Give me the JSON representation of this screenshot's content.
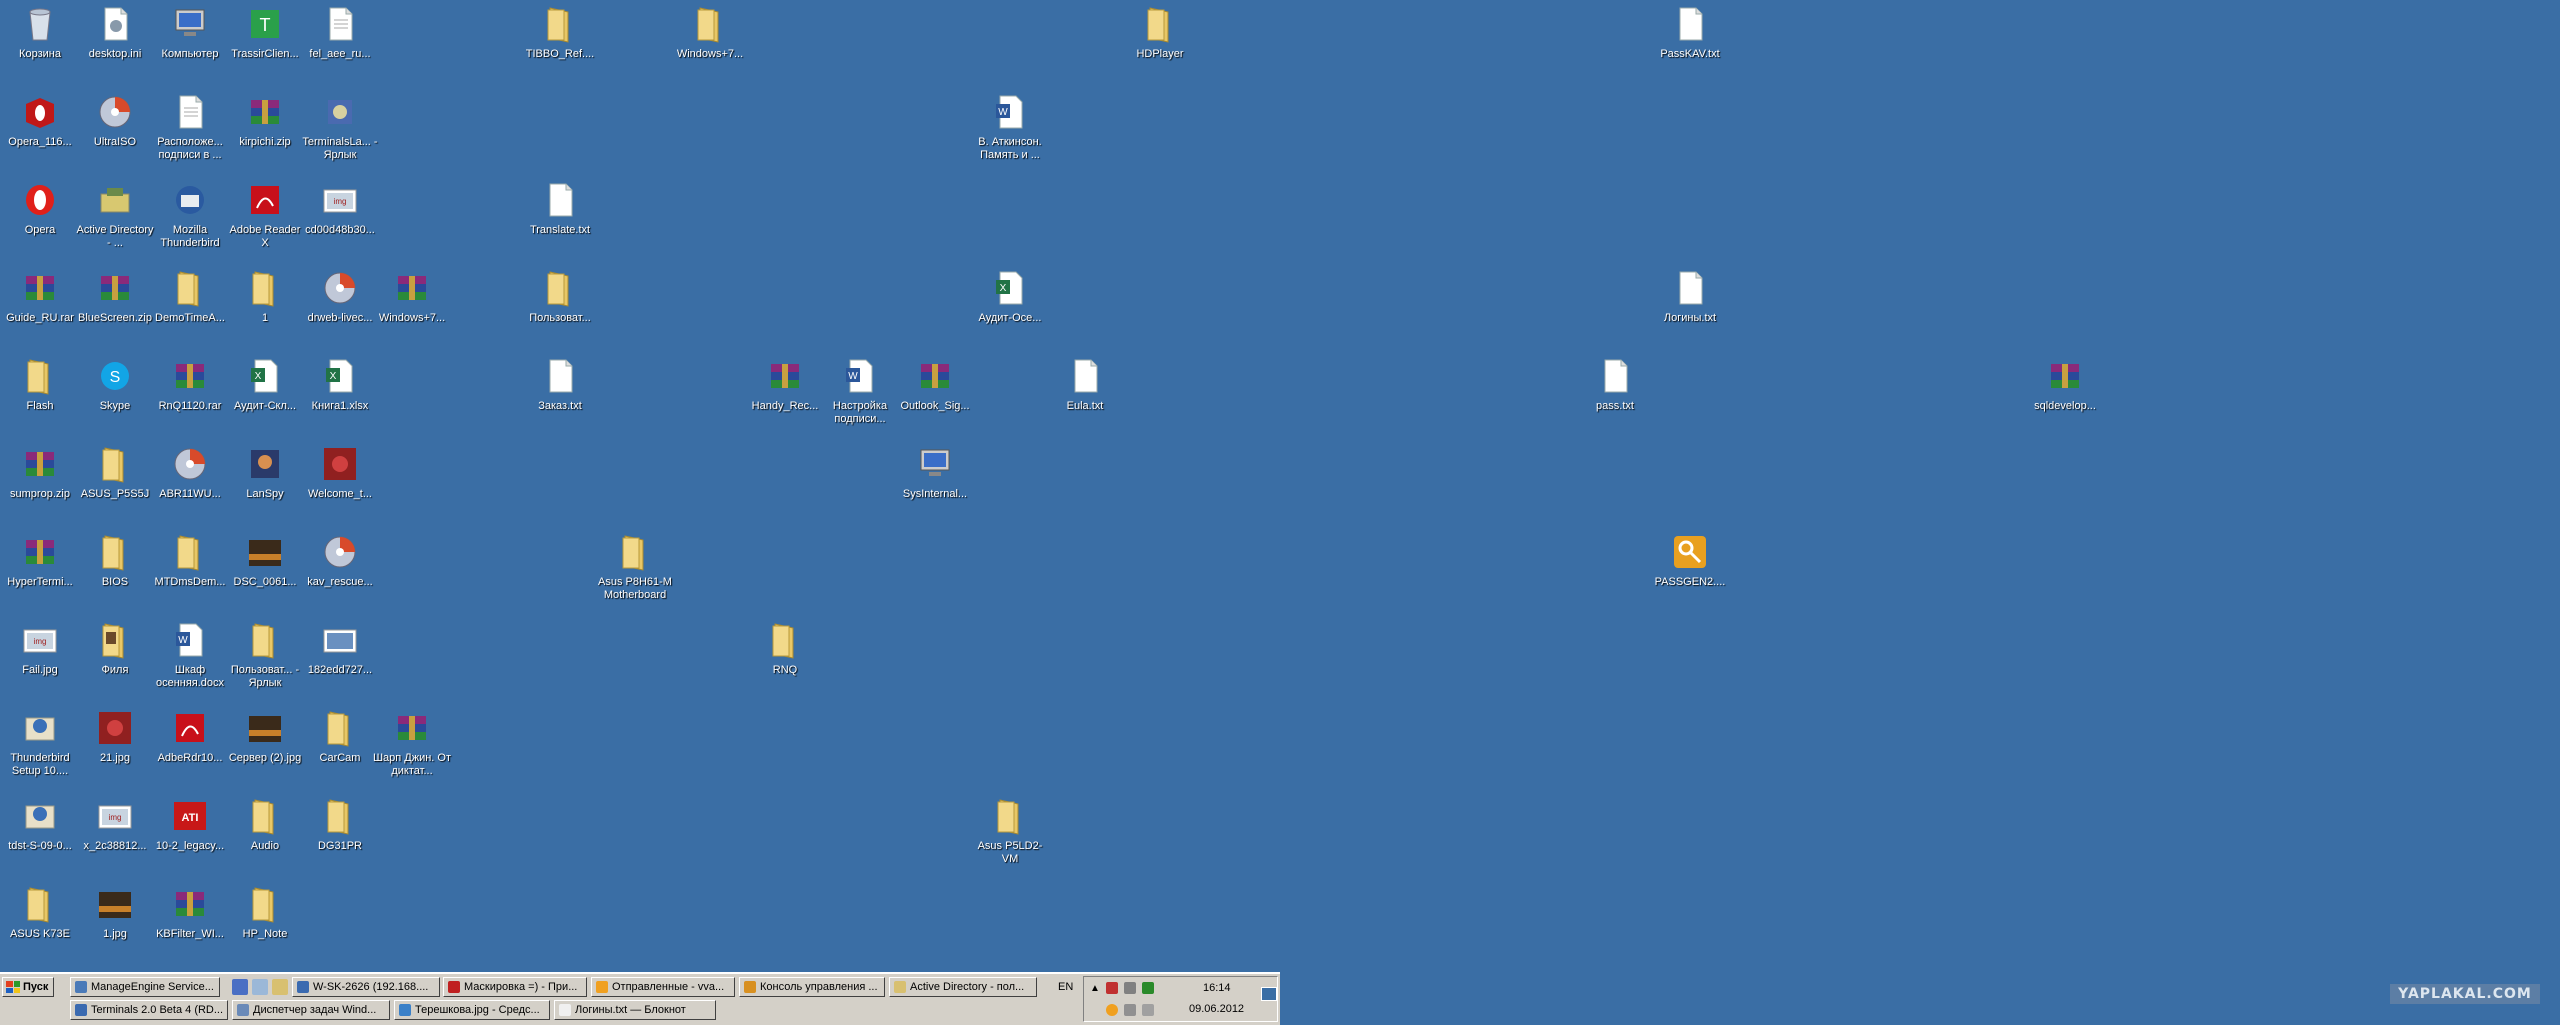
{
  "desktop": {
    "icons": [
      {
        "label": "Корзина",
        "type": "recycle"
      },
      {
        "label": "desktop.ini",
        "type": "ini"
      },
      {
        "label": "Компьютер",
        "type": "computer"
      },
      {
        "label": "TrassirClien...",
        "type": "app-green"
      },
      {
        "label": "fel_aee_ru...",
        "type": "doc"
      },
      {
        "label": "TIBBO_Ref....",
        "type": "folder"
      },
      {
        "label": "Windows+7...",
        "type": "folder"
      },
      {
        "label": "HDPlayer",
        "type": "folder"
      },
      {
        "label": "PassKAV.txt",
        "type": "txt"
      },
      {
        "label": "Opera_116...",
        "type": "opera-box"
      },
      {
        "label": "UltraISO",
        "type": "disc"
      },
      {
        "label": "Расположе... подписи в ...",
        "type": "doc"
      },
      {
        "label": "kirpichi.zip",
        "type": "rar"
      },
      {
        "label": "TerminalsLa... - Ярлык",
        "type": "app-shortcut"
      },
      {
        "label": "В. Аткинсон. Память и ...",
        "type": "word"
      },
      {
        "label": "Opera",
        "type": "opera"
      },
      {
        "label": "Active Directory - ...",
        "type": "tools"
      },
      {
        "label": "Mozilla Thunderbird",
        "type": "thunderbird"
      },
      {
        "label": "Adobe Reader X",
        "type": "pdf"
      },
      {
        "label": "cd00d48b30...",
        "type": "image"
      },
      {
        "label": "Translate.txt",
        "type": "txt"
      },
      {
        "label": "Guide_RU.rar",
        "type": "rar"
      },
      {
        "label": "BlueScreen.zip",
        "type": "rar"
      },
      {
        "label": "DemoTimeA...",
        "type": "folder"
      },
      {
        "label": "1",
        "type": "folder"
      },
      {
        "label": "drweb-livec...",
        "type": "disc"
      },
      {
        "label": "Windows+7...",
        "type": "rar"
      },
      {
        "label": "Пользоват...",
        "type": "folder"
      },
      {
        "label": "Аудит-Осе...",
        "type": "excel"
      },
      {
        "label": "Логины.txt",
        "type": "txt"
      },
      {
        "label": "Flash",
        "type": "folder"
      },
      {
        "label": "Skype",
        "type": "skype"
      },
      {
        "label": "RnQ1120.rar",
        "type": "rar"
      },
      {
        "label": "Аудит-Скл...",
        "type": "excel"
      },
      {
        "label": "Книга1.xlsx",
        "type": "excel"
      },
      {
        "label": "Заказ.txt",
        "type": "txt"
      },
      {
        "label": "Handy_Rec...",
        "type": "rar"
      },
      {
        "label": "Настройка подписи...",
        "type": "word"
      },
      {
        "label": "Outlook_Sig...",
        "type": "rar"
      },
      {
        "label": "Eula.txt",
        "type": "txt"
      },
      {
        "label": "pass.txt",
        "type": "txt"
      },
      {
        "label": "sqldevelop...",
        "type": "rar"
      },
      {
        "label": "sumprop.zip",
        "type": "rar"
      },
      {
        "label": "ASUS_P5S5J",
        "type": "folder"
      },
      {
        "label": "ABR11WU...",
        "type": "disc"
      },
      {
        "label": "LanSpy",
        "type": "lanspy"
      },
      {
        "label": "Welcome_t...",
        "type": "photo-red"
      },
      {
        "label": "SysInternal...",
        "type": "monitor"
      },
      {
        "label": "HyperTermi...",
        "type": "rar"
      },
      {
        "label": "BIOS",
        "type": "folder"
      },
      {
        "label": "MTDmsDem...",
        "type": "folder"
      },
      {
        "label": "DSC_0061...",
        "type": "photo-dark"
      },
      {
        "label": "kav_rescue...",
        "type": "disc"
      },
      {
        "label": "Asus P8H61-M Motherboard",
        "type": "folder"
      },
      {
        "label": "PASSGEN2....",
        "type": "key"
      },
      {
        "label": "Fail.jpg",
        "type": "image"
      },
      {
        "label": "Филя",
        "type": "folder-img"
      },
      {
        "label": "Шкаф осенняя.docx",
        "type": "word"
      },
      {
        "label": "Пользоват... - Ярлык",
        "type": "folder"
      },
      {
        "label": "182edd727...",
        "type": "photo-sky"
      },
      {
        "label": "RNQ",
        "type": "folder"
      },
      {
        "label": "Thunderbird Setup 10....",
        "type": "setup"
      },
      {
        "label": "21.jpg",
        "type": "photo-red"
      },
      {
        "label": "AdbeRdr10...",
        "type": "pdf"
      },
      {
        "label": "Сервер (2).jpg",
        "type": "photo-dark"
      },
      {
        "label": "CarCam",
        "type": "folder"
      },
      {
        "label": "Шарп Джин. От диктат...",
        "type": "rar"
      },
      {
        "label": "tdst-S-09-0...",
        "type": "setup"
      },
      {
        "label": "x_2c38812...",
        "type": "image"
      },
      {
        "label": "10-2_legacy...",
        "type": "ati"
      },
      {
        "label": "Audio",
        "type": "folder"
      },
      {
        "label": "DG31PR",
        "type": "folder"
      },
      {
        "label": "Asus P5LD2-VM",
        "type": "folder"
      },
      {
        "label": "ASUS K73E",
        "type": "folder"
      },
      {
        "label": "1.jpg",
        "type": "photo-dark"
      },
      {
        "label": "KBFilter_WI...",
        "type": "rar"
      },
      {
        "label": "HP_Note",
        "type": "folder"
      }
    ]
  },
  "taskbar": {
    "start_label": "Пуск",
    "row1": [
      {
        "label": "ManageEngine Service..."
      },
      {
        "label": "W-SK-2626 (192.168...."
      },
      {
        "label": "Маскировка =) - При..."
      },
      {
        "label": "Отправленные - vva..."
      },
      {
        "label": "Консоль управления ..."
      },
      {
        "label": "Active Directory - пол..."
      }
    ],
    "row2": [
      {
        "label": "Terminals 2.0 Beta 4 (RD..."
      },
      {
        "label": "Диспетчер задач Wind..."
      },
      {
        "label": "Терешкова.jpg - Средс..."
      },
      {
        "label": "Логины.txt — Блокнот"
      }
    ],
    "language": "EN",
    "time": "16:14",
    "date": "09.06.2012"
  },
  "watermark": "YAPLAKAL.COM",
  "colors": {
    "desktop": "#3a6ea5",
    "taskbar": "#d4d0c8",
    "folder": "#e8c766",
    "rar": "#7a3a8a"
  }
}
